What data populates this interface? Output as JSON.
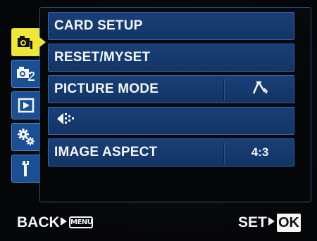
{
  "menu": {
    "tabs": [
      {
        "icon": "camera-1-icon",
        "active": true
      },
      {
        "icon": "camera-2-icon",
        "active": false
      },
      {
        "icon": "playback-icon",
        "active": false
      },
      {
        "icon": "custom-settings-gears-icon",
        "active": false
      },
      {
        "icon": "setup-wrench-icon",
        "active": false
      }
    ],
    "rows": [
      {
        "label": "CARD SETUP",
        "value": ""
      },
      {
        "label": "RESET/MYSET",
        "value": ""
      },
      {
        "label": "PICTURE MODE",
        "value": "",
        "value_icon": "natural-mode-icon"
      },
      {
        "label": "",
        "label_icon": "image-quality-icon",
        "value": ""
      },
      {
        "label": "IMAGE ASPECT",
        "value": "4:3"
      }
    ]
  },
  "bottom": {
    "back_label": "BACK",
    "menu_button": "MENU",
    "set_label": "SET",
    "ok_button": "OK"
  },
  "colors": {
    "row_blue": "#193f77",
    "tab_blue": "#1b4f93",
    "tab_active_yellow": "#f0e53a",
    "text": "#f4f6f8"
  }
}
